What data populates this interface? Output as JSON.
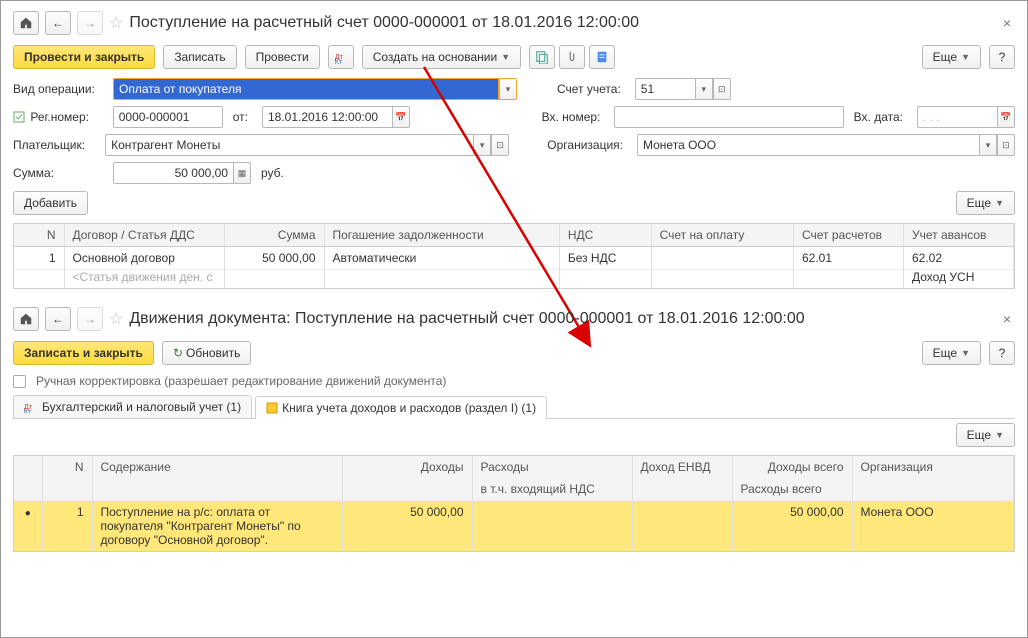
{
  "top": {
    "title": "Поступление на расчетный счет 0000-000001 от 18.01.2016 12:00:00",
    "toolbar": {
      "post_close": "Провести и закрыть",
      "write": "Записать",
      "post": "Провести",
      "create_based": "Создать на основании",
      "more": "Еще",
      "help": "?"
    },
    "fields": {
      "op_type_label": "Вид операции:",
      "op_type_value": "Оплата от покупателя",
      "account_label": "Счет учета:",
      "account_value": "51",
      "reg_no_label": "Рег.номер:",
      "reg_no_value": "0000-000001",
      "from_label": "от:",
      "from_value": "18.01.2016 12:00:00",
      "in_no_label": "Вх. номер:",
      "in_no_value": "",
      "in_date_label": "Вх. дата:",
      "in_date_value": ". . .",
      "payer_label": "Плательщик:",
      "payer_value": "Контрагент Монеты",
      "org_label": "Организация:",
      "org_value": "Монета ООО",
      "sum_label": "Сумма:",
      "sum_value": "50 000,00",
      "currency": "руб.",
      "add_btn": "Добавить"
    },
    "table": {
      "headers": {
        "n": "N",
        "contract": "Договор / Статья ДДС",
        "sum": "Сумма",
        "repay": "Погашение задолженности",
        "vat": "НДС",
        "invoice": "Счет на оплату",
        "settle": "Счет расчетов",
        "advance": "Учет авансов"
      },
      "row": {
        "n": "1",
        "contract": "Основной договор",
        "contract_sub": "<Статья движения ден. с",
        "sum": "50 000,00",
        "repay": "Автоматически",
        "vat": "Без НДС",
        "invoice": "",
        "settle": "62.01",
        "advance": "62.02",
        "advance_sub": "Доход УСН"
      }
    }
  },
  "bottom": {
    "title": "Движения документа: Поступление на расчетный счет 0000-000001 от 18.01.2016 12:00:00",
    "toolbar": {
      "write_close": "Записать и закрыть",
      "refresh": "Обновить",
      "more": "Еще",
      "help": "?"
    },
    "manual_label": "Ручная корректировка (разрешает редактирование движений документа)",
    "tabs": {
      "acc": "Бухгалтерский и налоговый учет (1)",
      "book": "Книга учета доходов и расходов (раздел I) (1)"
    },
    "table": {
      "headers": {
        "blank": "",
        "n": "N",
        "descr": "Содержание",
        "income": "Доходы",
        "expense": "Расходы",
        "expense_sub": "в т.ч. входящий НДС",
        "envd": "Доход ЕНВД",
        "income_all": "Доходы всего",
        "income_all_sub": "Расходы всего",
        "org": "Организация"
      },
      "row": {
        "n": "1",
        "descr": "Поступление на р/с: оплата от покупателя \"Контрагент Монеты\" по договору \"Основной договор\".",
        "income": "50 000,00",
        "expense": "",
        "envd": "",
        "income_all": "50 000,00",
        "org": "Монета ООО"
      }
    }
  }
}
